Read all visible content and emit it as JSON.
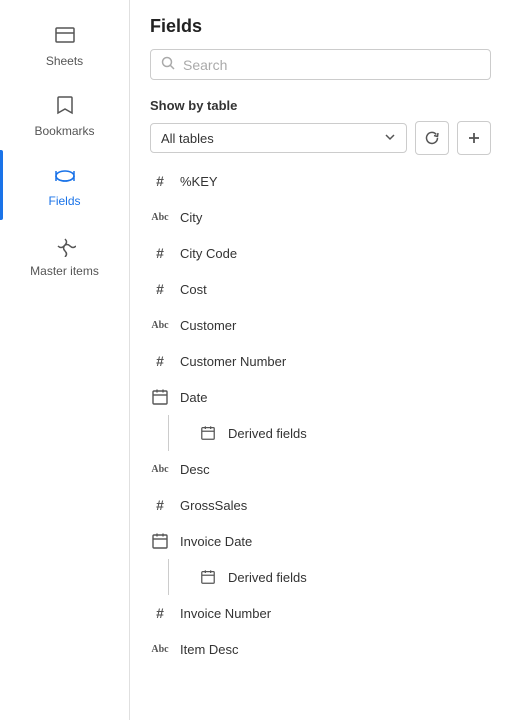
{
  "sidebar": {
    "items": [
      {
        "id": "sheets",
        "label": "Sheets",
        "icon": "sheets-icon"
      },
      {
        "id": "bookmarks",
        "label": "Bookmarks",
        "icon": "bookmarks-icon"
      },
      {
        "id": "fields",
        "label": "Fields",
        "icon": "fields-icon",
        "active": true
      },
      {
        "id": "master-items",
        "label": "Master items",
        "icon": "master-items-icon"
      }
    ]
  },
  "main": {
    "title": "Fields",
    "search": {
      "placeholder": "Search"
    },
    "show_by_table": {
      "label": "Show by table",
      "selected": "All tables"
    },
    "fields": [
      {
        "type": "hash",
        "name": "%KEY"
      },
      {
        "type": "abc",
        "name": "City"
      },
      {
        "type": "hash",
        "name": "City Code"
      },
      {
        "type": "hash",
        "name": "Cost"
      },
      {
        "type": "abc",
        "name": "Customer"
      },
      {
        "type": "hash",
        "name": "Customer Number"
      },
      {
        "type": "calendar",
        "name": "Date",
        "has_derived": true
      },
      {
        "type": "calendar",
        "name": "Derived fields",
        "indented": true
      },
      {
        "type": "abc",
        "name": "Desc"
      },
      {
        "type": "hash",
        "name": "GrossSales"
      },
      {
        "type": "calendar",
        "name": "Invoice Date",
        "has_derived": true
      },
      {
        "type": "calendar",
        "name": "Derived fields",
        "indented": true
      },
      {
        "type": "hash",
        "name": "Invoice Number"
      },
      {
        "type": "abc",
        "name": "Item Desc"
      }
    ]
  }
}
